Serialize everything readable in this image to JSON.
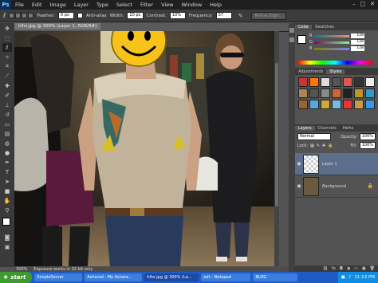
{
  "app": {
    "logo": "Ps"
  },
  "menu": [
    "File",
    "Edit",
    "Image",
    "Layer",
    "Type",
    "Select",
    "Filter",
    "View",
    "Window",
    "Help"
  ],
  "options": {
    "feather_label": "Feather:",
    "feather_value": "0 px",
    "antialias_label": "Anti-alias",
    "width_label": "Width:",
    "width_value": "10 px",
    "contrast_label": "Contrast:",
    "contrast_value": "10%",
    "frequency_label": "Frequency:",
    "frequency_value": "57",
    "refine_label": "Refine Edge..."
  },
  "document": {
    "tab_title": "hlhs.jpg @ 300% (Layer 1, RGB/8#)"
  },
  "status": {
    "zoom": "300%",
    "message": "Exposure works in 32-bit only"
  },
  "color_panel": {
    "tabs": [
      "Color",
      "Swatches"
    ],
    "r_label": "R",
    "r_value": "128",
    "g_label": "G",
    "g_value": "128",
    "b_label": "B",
    "b_value": "128"
  },
  "styles_panel": {
    "tabs": [
      "Adjustments",
      "Styles"
    ]
  },
  "layers_panel": {
    "tabs": [
      "Layers",
      "Channels",
      "Paths"
    ],
    "blend_mode": "Normal",
    "opacity_label": "Opacity:",
    "opacity_value": "100%",
    "lock_label": "Lock:",
    "fill_label": "Fill:",
    "fill_value": "100%",
    "layers": [
      {
        "name": "Layer 1",
        "selected": true
      },
      {
        "name": "Background",
        "selected": false
      }
    ]
  },
  "taskbar": {
    "start": "start",
    "tasks": [
      "SimpleServer",
      "Ashared - My Ashare...",
      "hlhs.jpg @ 300% (La...",
      "edt - Notepad",
      "BLOG"
    ],
    "clock": "11:13 PM"
  },
  "colors": {
    "accent": "#1e5bc6",
    "selected_layer": "#5b6e8c"
  }
}
